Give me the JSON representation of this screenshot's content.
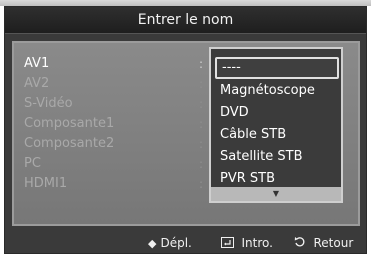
{
  "title": "Entrer le nom",
  "sources": [
    {
      "label": "AV1",
      "active": true
    },
    {
      "label": "AV2"
    },
    {
      "label": "S-Vidéo"
    },
    {
      "label": "Composante1"
    },
    {
      "label": "Composante2"
    },
    {
      "label": "PC"
    },
    {
      "label": "HDMI1"
    }
  ],
  "colon": ":",
  "dropdown": {
    "options": [
      "----",
      "Magnétoscope",
      "DVD",
      "Câble STB",
      "Satellite STB",
      "PVR STB"
    ],
    "selected_index": 0,
    "more_indicator": "▼"
  },
  "footer": {
    "move_icon": "◆",
    "move_label": "Dépl.",
    "enter_icon": "enter-icon",
    "enter_label": "Intro.",
    "return_icon": "return-icon",
    "return_label": "Retour"
  }
}
